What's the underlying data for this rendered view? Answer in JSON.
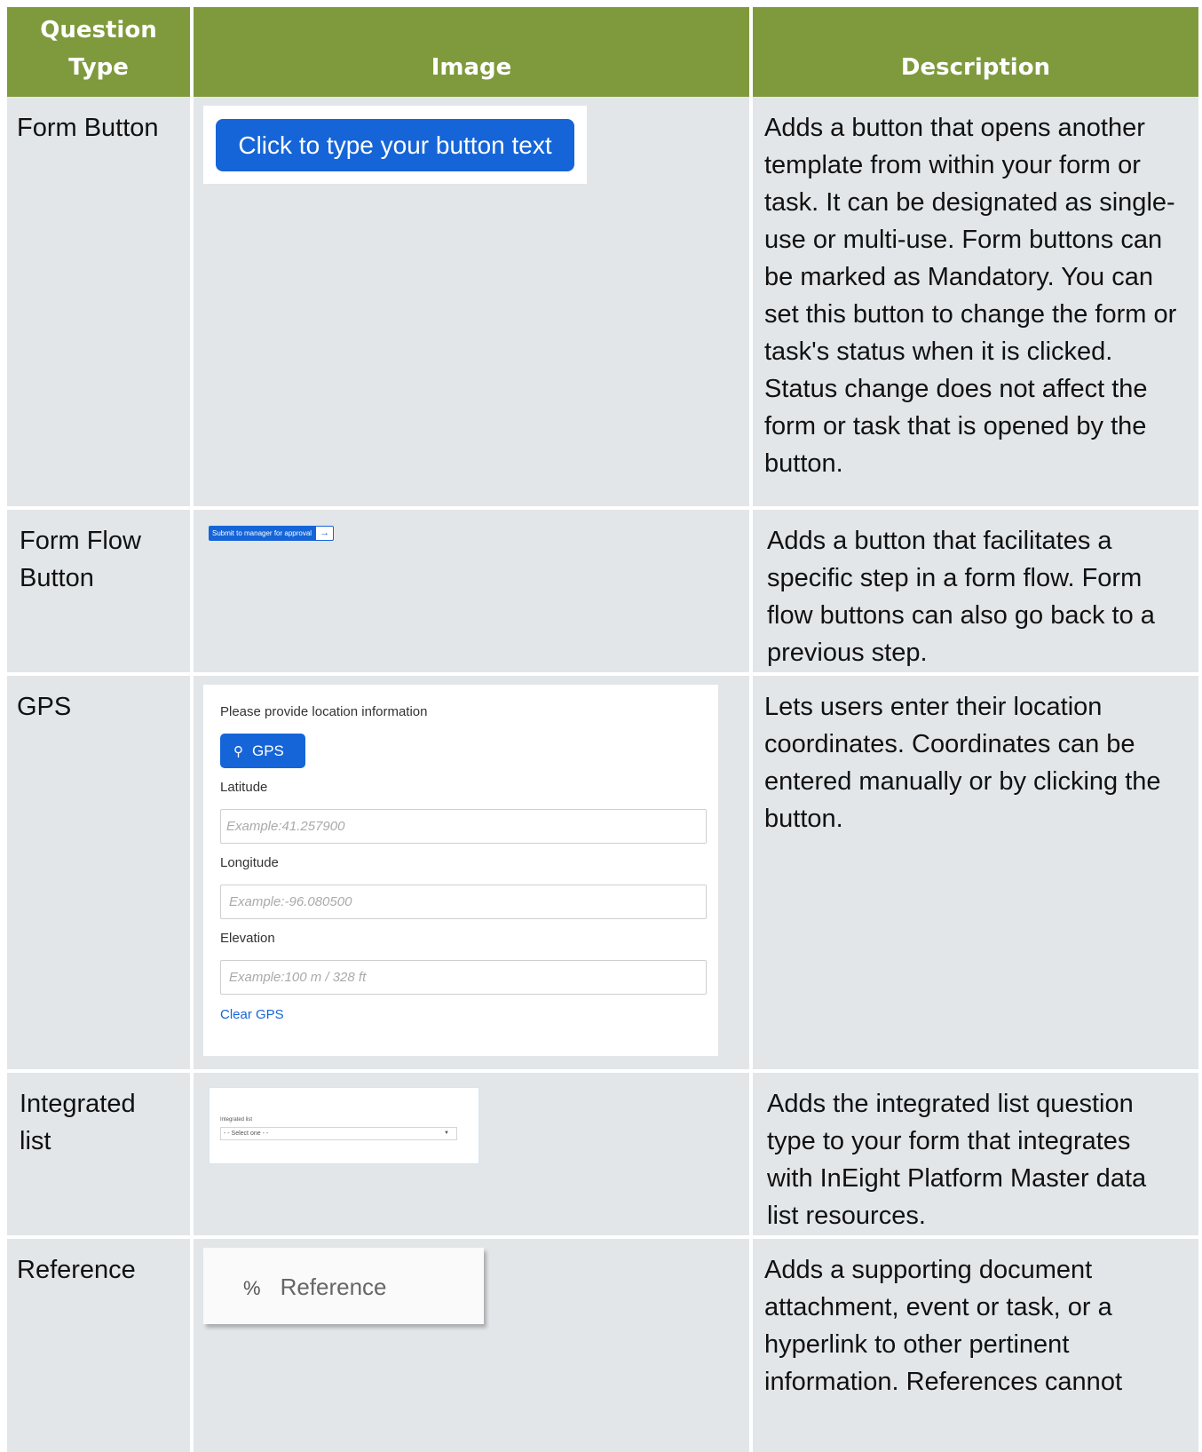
{
  "headers": {
    "question_type": "Question Type",
    "image": "Image",
    "description": "Description"
  },
  "rows": [
    {
      "type": "Form Button",
      "description": "Adds a button that opens another template from within your form or task. It can be designated as single-use or multi-use. Form buttons can be marked as Mandatory. You can set this button to change the form or task's status when it is clicked. Status change does not affect the form or task that is opened by the button.",
      "button_text": "Click to type your button text"
    },
    {
      "type": "Form Flow Button",
      "description": "Adds a button that facilitates a specific step in a form flow. Form flow buttons can also go back to a previous step.",
      "button_text": "Submit to manager for approval",
      "arrow": "→"
    },
    {
      "type": "GPS",
      "description": "Lets users enter their location coordinates. Coordinates can be entered manually or by clicking the button.",
      "prompt": "Please provide location information",
      "button_text": "GPS",
      "pin_icon": "⚲",
      "latitude_label": "Latitude",
      "latitude_placeholder": "Example:41.257900",
      "longitude_label": "Longitude",
      "longitude_placeholder": "Example:-96.080500",
      "elevation_label": "Elevation",
      "elevation_placeholder": "Example:100 m / 328 ft",
      "clear_text": "Clear GPS"
    },
    {
      "type": "Integrated list",
      "description": "Adds the integrated list question type to your form that integrates with InEight Platform Master data list resources.",
      "field_label": "Integrated list",
      "select_value": "- - Select one - -"
    },
    {
      "type": "Reference",
      "description": "Adds a supporting document attachment, event or task, or a hyperlink to other pertinent information. References cannot",
      "button_text": "Reference",
      "link_icon": "%"
    }
  ],
  "colors": {
    "header_bg": "#7f9a3c",
    "cell_bg": "#e3e6e9",
    "accent_blue": "#1565d8"
  }
}
